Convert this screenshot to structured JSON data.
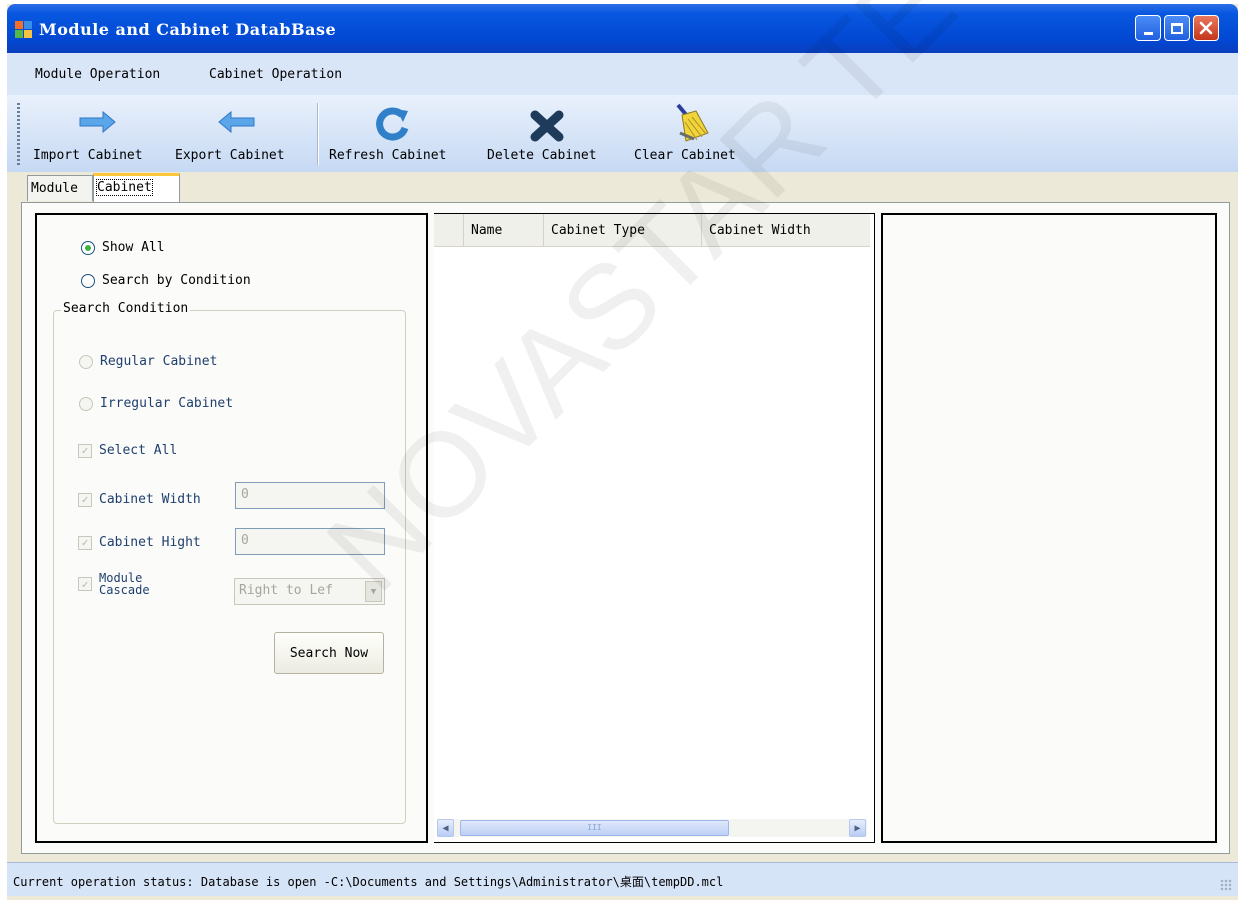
{
  "window": {
    "title": "Module and Cabinet DatabBase",
    "controls": [
      "minimize-icon",
      "maximize-icon",
      "close-icon"
    ]
  },
  "menu": [
    "Module Operation",
    "Cabinet Operation"
  ],
  "toolbar": [
    {
      "label": "Import Cabinet",
      "icon": "arrow-right-icon"
    },
    {
      "label": "Export Cabinet",
      "icon": "arrow-left-icon"
    },
    {
      "label": "Refresh Cabinet",
      "icon": "refresh-icon"
    },
    {
      "label": "Delete Cabinet",
      "icon": "delete-x-icon"
    },
    {
      "label": "Clear Cabinet",
      "icon": "broom-icon"
    }
  ],
  "tabs": [
    {
      "label": "Module",
      "selected": false
    },
    {
      "label": "Cabinet",
      "selected": true
    }
  ],
  "filter": {
    "show_all": "Show All",
    "search_by_condition": "Search by Condition",
    "selected_mode": "Show All",
    "group_title": "Search Condition",
    "regular": "Regular Cabinet",
    "irregular": "Irregular Cabinet",
    "select_all": "Select All",
    "width_label": "Cabinet Width",
    "width_value": "0",
    "height_label": "Cabinet Hight",
    "height_value": "0",
    "cascade_label_1": "Module",
    "cascade_label_2": "Cascade",
    "cascade_value": "Right to Lef",
    "search_button": "Search Now"
  },
  "grid": {
    "columns": [
      "Name",
      "Cabinet Type",
      "Cabinet Width"
    ],
    "rows": [],
    "scroll_thumb_glyph": "III"
  },
  "status": {
    "text": "Current operation status: Database is open -C:\\Documents and Settings\\Administrator\\桌面\\tempDD.mcl"
  },
  "watermark": "NOVASTAR TECH CO., L.",
  "colors": {
    "titlebar": "#0247d1",
    "menubar": "#d9e6f8",
    "tab_accent": "#ffc83c",
    "radio_checked": "#3fb13f",
    "delete_icon": "#1f3b5c"
  }
}
